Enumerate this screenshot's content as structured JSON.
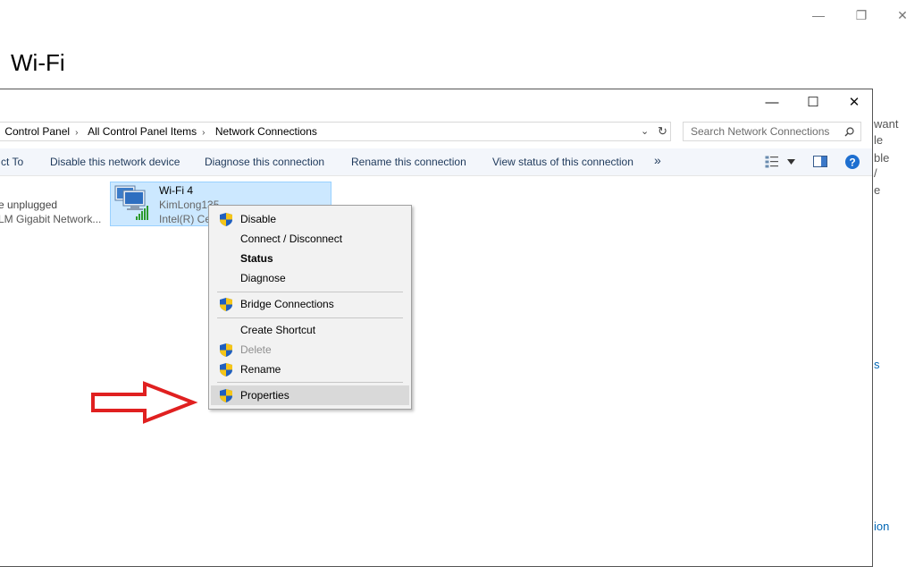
{
  "background_window": {
    "title": "Wi-Fi",
    "controls": {
      "minimize": "—",
      "restore": "❐",
      "close": "✕"
    },
    "right_fragments": [
      "want",
      "le",
      "ble",
      "/",
      "e"
    ],
    "right_char": "s",
    "link_fragment": "ion"
  },
  "explorer": {
    "controls": {
      "minimize": "—",
      "maximize": "☐",
      "close": "✕"
    },
    "breadcrumb": [
      "Control Panel",
      "All Control Panel Items",
      "Network Connections"
    ],
    "search_placeholder": "Search Network Connections",
    "commands": [
      "ct To",
      "Disable this network device",
      "Diagnose this connection",
      "Rename this connection",
      "View status of this connection"
    ],
    "more_label": "»",
    "items": [
      {
        "line1": "e unplugged",
        "line2": "LM Gigabit Network..."
      },
      {
        "name": "Wi-Fi 4",
        "network": "KimLong135",
        "adapter": "Intel(R) Ce"
      }
    ]
  },
  "context_menu": {
    "items": [
      {
        "label": "Disable",
        "shield": true
      },
      {
        "label": "Connect / Disconnect",
        "shield": false
      },
      {
        "label": "Status",
        "shield": false,
        "bold": true
      },
      {
        "label": "Diagnose",
        "shield": false
      },
      {
        "label": "Bridge Connections",
        "shield": true
      },
      {
        "label": "Create Shortcut",
        "shield": false
      },
      {
        "label": "Delete",
        "shield": true,
        "disabled": true
      },
      {
        "label": "Rename",
        "shield": true
      },
      {
        "label": "Properties",
        "shield": true,
        "highlighted": true
      }
    ]
  },
  "colors": {
    "accent": "#0066b4",
    "selection": "#cce8ff",
    "arrow": "#e02020",
    "help": "#1e6fd0"
  }
}
